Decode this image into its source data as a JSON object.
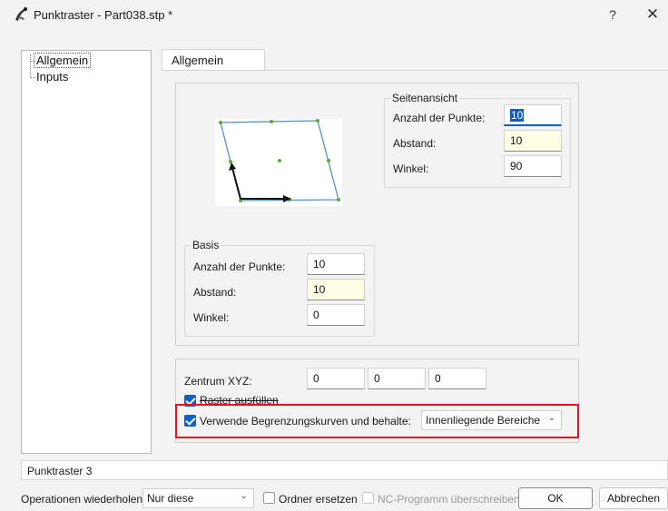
{
  "window": {
    "title": "Punktraster - Part038.stp *",
    "help_label": "?",
    "close_label": "✕"
  },
  "tree": {
    "items": [
      {
        "label": "Allgemein"
      },
      {
        "label": "Inputs"
      }
    ]
  },
  "tab": {
    "label": "Allgemein"
  },
  "seitenansicht": {
    "legend": "Seitenansicht",
    "anzahl_label": "Anzahl der Punkte:",
    "anzahl_value": "10",
    "abstand_label": "Abstand:",
    "abstand_value": "10",
    "winkel_label": "Winkel:",
    "winkel_value": "90"
  },
  "basis": {
    "legend": "Basis",
    "anzahl_label": "Anzahl der Punkte:",
    "anzahl_value": "10",
    "abstand_label": "Abstand:",
    "abstand_value": "10",
    "winkel_label": "Winkel:",
    "winkel_value": "0"
  },
  "zentrum": {
    "label": "Zentrum XYZ:",
    "x": "0",
    "y": "0",
    "z": "0"
  },
  "options": {
    "raster_fuellen_label": "Raster ausfüllen",
    "raster_fuellen_checked": true,
    "begrenzung_label": "Verwende Begrenzungskurven und behalte:",
    "begrenzung_checked": true,
    "begrenzung_value": "Innenliegende Bereiche"
  },
  "status": {
    "text": "Punktraster 3"
  },
  "footer": {
    "repeat_label": "Operationen wiederholen:",
    "repeat_value": "Nur diese",
    "ordner_label": "Ordner ersetzen",
    "nc_label": "NC-Programm überschreiben",
    "ok_label": "OK",
    "cancel_label": "Abbrechen"
  },
  "colors": {
    "accent": "#0f62c3",
    "highlight_box": "#d9161b",
    "field_yellow": "#fefde4"
  }
}
